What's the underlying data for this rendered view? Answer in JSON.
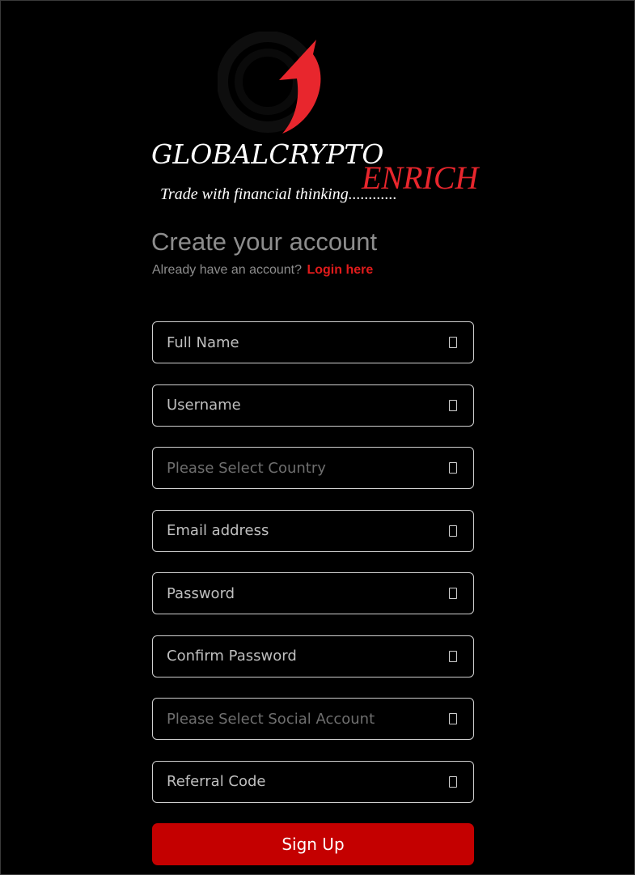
{
  "brand": {
    "name_main": "GLOBALCRYPTO",
    "name_accent": "ENRICH",
    "tagline": "Trade with financial thinking............",
    "accent_color": "#e8262d"
  },
  "header": {
    "title": "Create your account",
    "prompt": "Already have an account?",
    "login_link": "Login here"
  },
  "form": {
    "fields": [
      {
        "placeholder": "Full Name",
        "icon": "user-icon"
      },
      {
        "placeholder": "Username",
        "icon": "at-icon"
      },
      {
        "placeholder": "Please Select Country",
        "icon": "globe-icon"
      },
      {
        "placeholder": "Email address",
        "icon": "envelope-icon"
      },
      {
        "placeholder": "Password",
        "icon": "lock-icon"
      },
      {
        "placeholder": "Confirm Password",
        "icon": "lock-icon"
      },
      {
        "placeholder": "Please Select Social Account",
        "icon": "share-icon"
      },
      {
        "placeholder": "Referral Code",
        "icon": "gift-icon"
      }
    ],
    "submit_label": "Sign Up",
    "submit_color": "#c40000"
  }
}
